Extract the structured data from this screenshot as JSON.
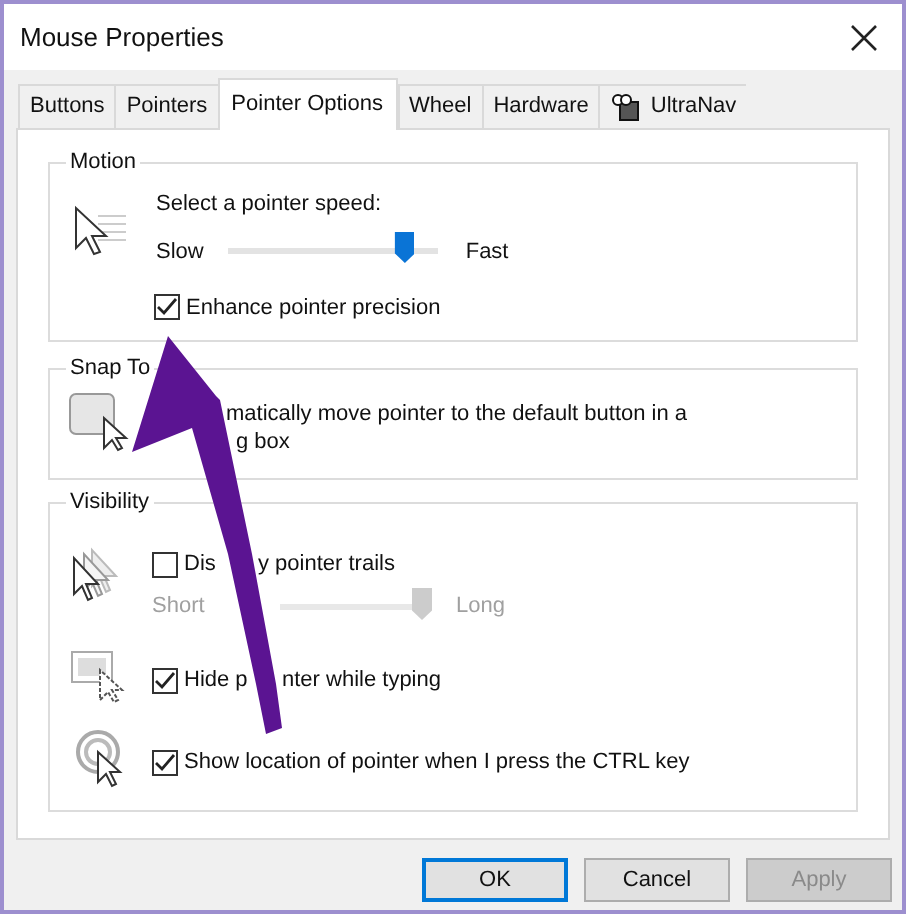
{
  "window": {
    "title": "Mouse Properties"
  },
  "tabs": [
    {
      "label": "Buttons",
      "selected": false
    },
    {
      "label": "Pointers",
      "selected": false
    },
    {
      "label": "Pointer Options",
      "selected": true
    },
    {
      "label": "Wheel",
      "selected": false
    },
    {
      "label": "Hardware",
      "selected": false
    },
    {
      "label": "UltraNav",
      "selected": false,
      "kind": "icon"
    }
  ],
  "motion": {
    "title": "Motion",
    "prompt": "Select a pointer speed:",
    "slow": "Slow",
    "fast": "Fast",
    "speed": {
      "level": 0.88
    },
    "precision": {
      "label": "Enhance pointer precision",
      "checked": true
    }
  },
  "snap_to": {
    "title": "Snap To",
    "text_parts": [
      "matically move pointer to the default button in a",
      "g box"
    ]
  },
  "visibility": {
    "title": "Visibility",
    "trails": {
      "label_parts": [
        "Dis",
        "y pointer trails"
      ],
      "checked": false,
      "short": "Short",
      "long": "Long",
      "length": {
        "level": 1.0
      },
      "disabled": true
    },
    "hide": {
      "label_parts": [
        "Hide p",
        "nter while typing"
      ],
      "checked": true
    },
    "ctrl": {
      "label": "Show location of pointer when I press the CTRL key",
      "checked": true
    }
  },
  "buttons": [
    {
      "label": "OK",
      "kind": "default",
      "disabled": false
    },
    {
      "label": "Cancel",
      "kind": "normal",
      "disabled": false
    },
    {
      "label": "Apply",
      "kind": "normal",
      "disabled": true
    }
  ],
  "annotation": {
    "kind": "arrow",
    "color": "#5b1492"
  }
}
